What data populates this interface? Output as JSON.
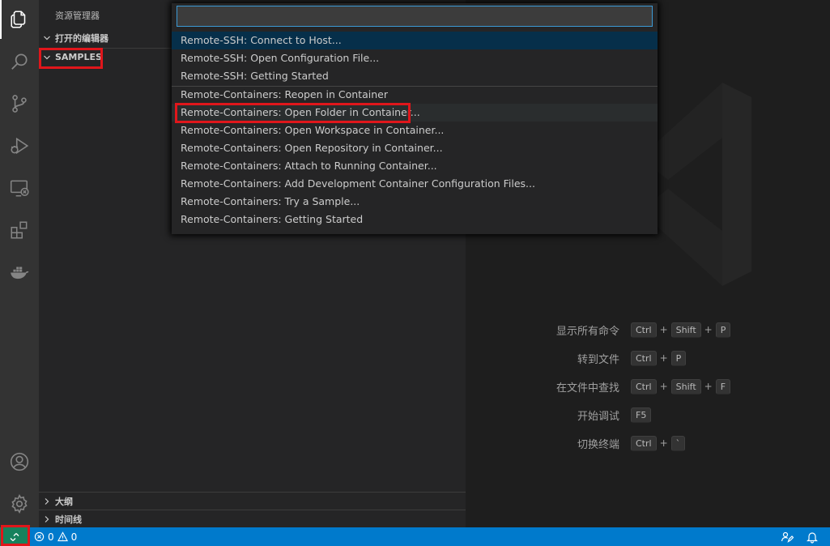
{
  "sidebar": {
    "title": "资源管理器",
    "sections": {
      "open_editors": "打开的编辑器",
      "samples": "SAMPLES",
      "outline": "大纲",
      "timeline": "时间线"
    }
  },
  "palette": {
    "input_value": "",
    "items": [
      "Remote-SSH: Connect to Host...",
      "Remote-SSH: Open Configuration File...",
      "Remote-SSH: Getting Started",
      "Remote-Containers: Reopen in Container",
      "Remote-Containers: Open Folder in Container...",
      "Remote-Containers: Open Workspace in Container...",
      "Remote-Containers: Open Repository in Container...",
      "Remote-Containers: Attach to Running Container...",
      "Remote-Containers: Add Development Container Configuration Files...",
      "Remote-Containers: Try a Sample...",
      "Remote-Containers: Getting Started"
    ]
  },
  "shortcuts": [
    {
      "label": "显示所有命令",
      "keys": [
        "Ctrl",
        "Shift",
        "P"
      ]
    },
    {
      "label": "转到文件",
      "keys": [
        "Ctrl",
        "P"
      ]
    },
    {
      "label": "在文件中查找",
      "keys": [
        "Ctrl",
        "Shift",
        "F"
      ]
    },
    {
      "label": "开始调试",
      "keys": [
        "F5"
      ]
    },
    {
      "label": "切换终端",
      "keys": [
        "Ctrl",
        "`"
      ]
    }
  ],
  "statusbar": {
    "errors": "0",
    "warnings": "0"
  },
  "colors": {
    "activity_bar": "#333333",
    "sidebar": "#252526",
    "editor": "#1e1e1e",
    "statusbar": "#007acc",
    "remote_indicator": "#16825d",
    "highlight": "#e0161b",
    "selection": "#062f4a",
    "input_border": "#3c9ad5"
  }
}
